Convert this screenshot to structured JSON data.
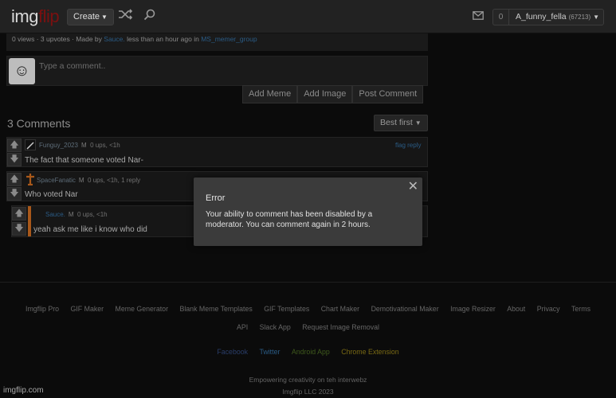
{
  "header": {
    "logo_part1": "img",
    "logo_part2": "flip",
    "create_label": "Create",
    "notification_count": "0",
    "username": "A_funny_fella",
    "points": "(67213)"
  },
  "post": {
    "stats_prefix": "0 views · 3 upvotes · Made by ",
    "author": "Sauce.",
    "stats_middle": " less than an hour ago in ",
    "stream": "MS_memer_group"
  },
  "composer": {
    "placeholder": "Type a comment..",
    "add_meme": "Add Meme",
    "add_image": "Add Image",
    "post_comment": "Post Comment"
  },
  "comments_section": {
    "count_label": "3 Comments",
    "sort_label": "Best first",
    "comments": [
      {
        "username": "Funguy_2023",
        "badge": "M",
        "meta": "0 ups, <1h",
        "text": "The fact that someone voted Nar-",
        "flag": "flag reply"
      },
      {
        "username": "SpaceFanatic",
        "badge": "M",
        "meta": "0 ups, <1h, 1 reply",
        "text": "Who voted Nar"
      },
      {
        "username": "Sauce.",
        "badge": "M",
        "meta": "0 ups, <1h",
        "text": "yeah ask me like i know who did"
      }
    ]
  },
  "modal": {
    "title": "Error",
    "message": "Your ability to comment has been disabled by a moderator. You can comment again in 2 hours.",
    "close_glyph": "✕"
  },
  "footer": {
    "links": [
      "Imgflip Pro",
      "GIF Maker",
      "Meme Generator",
      "Blank Meme Templates",
      "GIF Templates",
      "Chart Maker",
      "Demotivational Maker",
      "Image Resizer",
      "About",
      "Privacy",
      "Terms",
      "API",
      "Slack App",
      "Request Image Removal"
    ],
    "apps": [
      {
        "label": "Facebook",
        "color": "#2a3e6a"
      },
      {
        "label": "Twitter",
        "color": "#2a5b85"
      },
      {
        "label": "Android App",
        "color": "#3f5a1c"
      },
      {
        "label": "Chrome Extension",
        "color": "#7a6a14"
      }
    ],
    "tagline": "Empowering creativity on teh interwebz",
    "copyright": "Imgflip LLC 2023"
  },
  "watermark": "imgflip.com",
  "icons": {
    "shuffle": "shuffle-icon",
    "search": "search-icon",
    "mail": "mail-icon",
    "upvote": "up-arrow-icon",
    "downvote": "down-arrow-icon"
  }
}
